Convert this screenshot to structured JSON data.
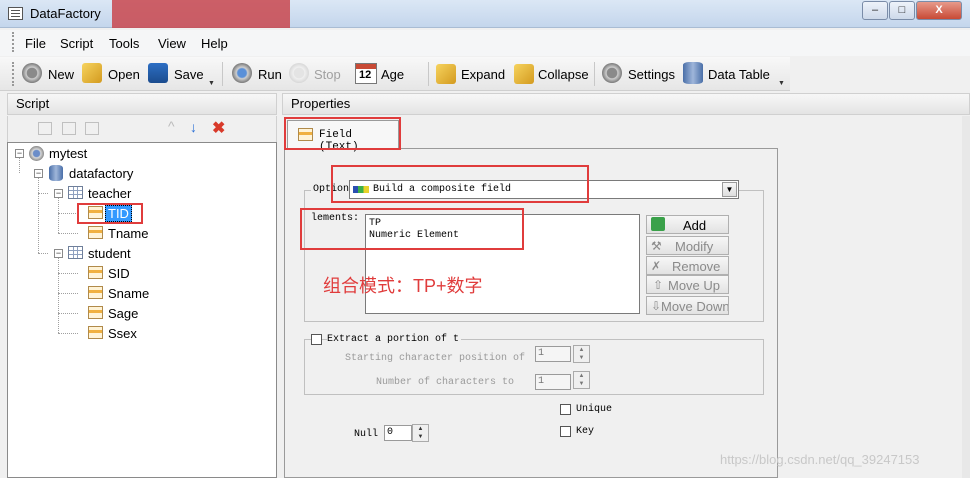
{
  "window": {
    "title": "DataFactory",
    "minimize": "–",
    "maximize": "□",
    "close": "X"
  },
  "menu": [
    "File",
    "Script",
    "Tools",
    "View",
    "Help"
  ],
  "toolbar": {
    "new": "New",
    "open": "Open",
    "save": "Save",
    "run": "Run",
    "stop": "Stop",
    "age": "Age",
    "age_icon_text": "12",
    "expand": "Expand",
    "collapse": "Collapse",
    "settings": "Settings",
    "data_table": "Data Table"
  },
  "script_pane": {
    "title": "Script",
    "tree": {
      "root": "mytest",
      "database": "datafactory",
      "tables": [
        {
          "name": "teacher",
          "fields": [
            "TID",
            "Tname"
          ]
        },
        {
          "name": "student",
          "fields": [
            "SID",
            "Sname",
            "Sage",
            "Ssex"
          ]
        }
      ]
    }
  },
  "properties_pane": {
    "title": "Properties",
    "tab": "Field (Text)",
    "option_label": "Option",
    "option_value": "Build a composite field",
    "elements_label": "lements:",
    "elements": [
      "TP",
      "Numeric Element"
    ],
    "buttons": {
      "add": "Add",
      "modify": "Modify",
      "remove": "Remove",
      "move_up": "Move Up",
      "move_down": "Move Down"
    },
    "extract_label": "Extract a portion of t",
    "start_label": "Starting character position of",
    "start_value": "1",
    "count_label": "Number of characters to",
    "count_value": "1",
    "unique_label": "Unique",
    "key_label": "Key",
    "null_label": "Null",
    "null_value": "0"
  },
  "annotation": "组合模式：TP+数字",
  "watermark": "https://blog.csdn.net/qq_39247153",
  "colors": {
    "highlight_red": "#e03c3c",
    "selection_blue": "#3399ff"
  }
}
